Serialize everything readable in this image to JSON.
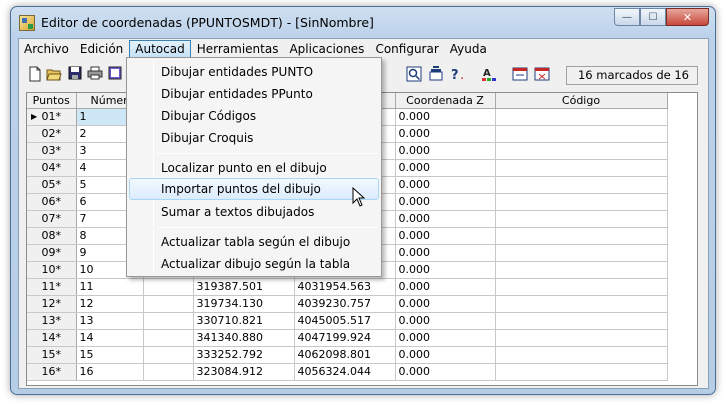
{
  "window": {
    "title": "Editor de coordenadas (PPUNTOSMDT) - [SinNombre]",
    "minimize": "—",
    "maximize": "☐",
    "close": "✕"
  },
  "menubar": {
    "items": [
      "Archivo",
      "Edición",
      "Autocad",
      "Herramientas",
      "Aplicaciones",
      "Configurar",
      "Ayuda"
    ],
    "active": "Autocad"
  },
  "toolbar": {
    "icons": [
      "new-icon",
      "open-icon",
      "save-icon",
      "print-icon",
      "edit-icon",
      "zoom-icon",
      "block-icon",
      "query-icon",
      "text-color-icon",
      "window-icon",
      "window-close-icon"
    ],
    "marked_count": "16 marcados de 16"
  },
  "autocad_menu": {
    "items": [
      "Dibujar entidades PUNTO",
      "Dibujar entidades PPunto",
      "Dibujar Códigos",
      "Dibujar Croquis",
      "Localizar punto en el dibujo",
      "Importar puntos del dibujo",
      "Sumar a textos dibujados",
      "Actualizar tabla según el dibujo",
      "Actualizar dibujo según la tabla"
    ],
    "hovered": "Importar puntos del dibujo"
  },
  "table": {
    "columns": [
      "Puntos",
      "Númer",
      "",
      "",
      "Coordenada Z",
      "Código"
    ],
    "rows": [
      [
        "01*",
        "1",
        "",
        "",
        "0.000",
        ""
      ],
      [
        "02*",
        "2",
        "",
        "",
        "0.000",
        ""
      ],
      [
        "03*",
        "3",
        "",
        "",
        "0.000",
        ""
      ],
      [
        "04*",
        "4",
        "",
        "",
        "0.000",
        ""
      ],
      [
        "05*",
        "5",
        "",
        "",
        "0.000",
        ""
      ],
      [
        "06*",
        "6",
        "",
        "",
        "0.000",
        ""
      ],
      [
        "07*",
        "7",
        "",
        "",
        "0.000",
        ""
      ],
      [
        "08*",
        "8",
        "",
        "",
        "0.000",
        ""
      ],
      [
        "09*",
        "9",
        "",
        "",
        "0.000",
        ""
      ],
      [
        "10*",
        "10",
        "",
        "",
        "0.000",
        ""
      ],
      [
        "11*",
        "11",
        "319387.501",
        "4031954.563",
        "0.000",
        ""
      ],
      [
        "12*",
        "12",
        "319734.130",
        "4039230.757",
        "0.000",
        ""
      ],
      [
        "13*",
        "13",
        "330710.821",
        "4045005.517",
        "0.000",
        ""
      ],
      [
        "14*",
        "14",
        "341340.880",
        "4047199.924",
        "0.000",
        ""
      ],
      [
        "15*",
        "15",
        "333252.792",
        "4062098.801",
        "0.000",
        ""
      ],
      [
        "16*",
        "16",
        "323084.912",
        "4056324.044",
        "0.000",
        ""
      ]
    ]
  }
}
